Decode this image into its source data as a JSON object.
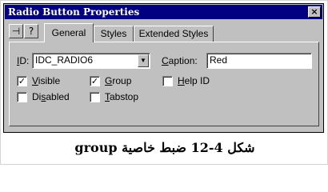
{
  "window": {
    "title": "Radio Button Properties",
    "close_glyph": "×"
  },
  "toolbar": {
    "pin_icon": "push-pin-icon",
    "help_icon": "help-icon",
    "pin_glyph": "⊣",
    "help_glyph": "?"
  },
  "tabs": [
    {
      "label": "General",
      "active": true
    },
    {
      "label": "Styles",
      "active": false
    },
    {
      "label": "Extended Styles",
      "active": false
    }
  ],
  "form": {
    "id_label_key": "I",
    "id_label_rest": "D:",
    "id_value": "IDC_RADIO6",
    "dropdown_glyph": "▼",
    "caption_label_key": "C",
    "caption_label_rest": "aption:",
    "caption_value": "Red"
  },
  "checkboxes": {
    "visible": {
      "key": "V",
      "rest": "isible",
      "checked": true
    },
    "group": {
      "key": "G",
      "rest": "roup",
      "checked": true
    },
    "help_id": {
      "key": "H",
      "rest": "elp ID",
      "checked": false
    },
    "disabled": {
      "pre": "Di",
      "key": "s",
      "rest": "abled",
      "checked": false
    },
    "tabstop": {
      "key": "T",
      "rest": "abstop",
      "checked": false
    }
  },
  "check_glyph": "✓",
  "figure_caption": "شكل 4-12 ضبط خاصية  group"
}
